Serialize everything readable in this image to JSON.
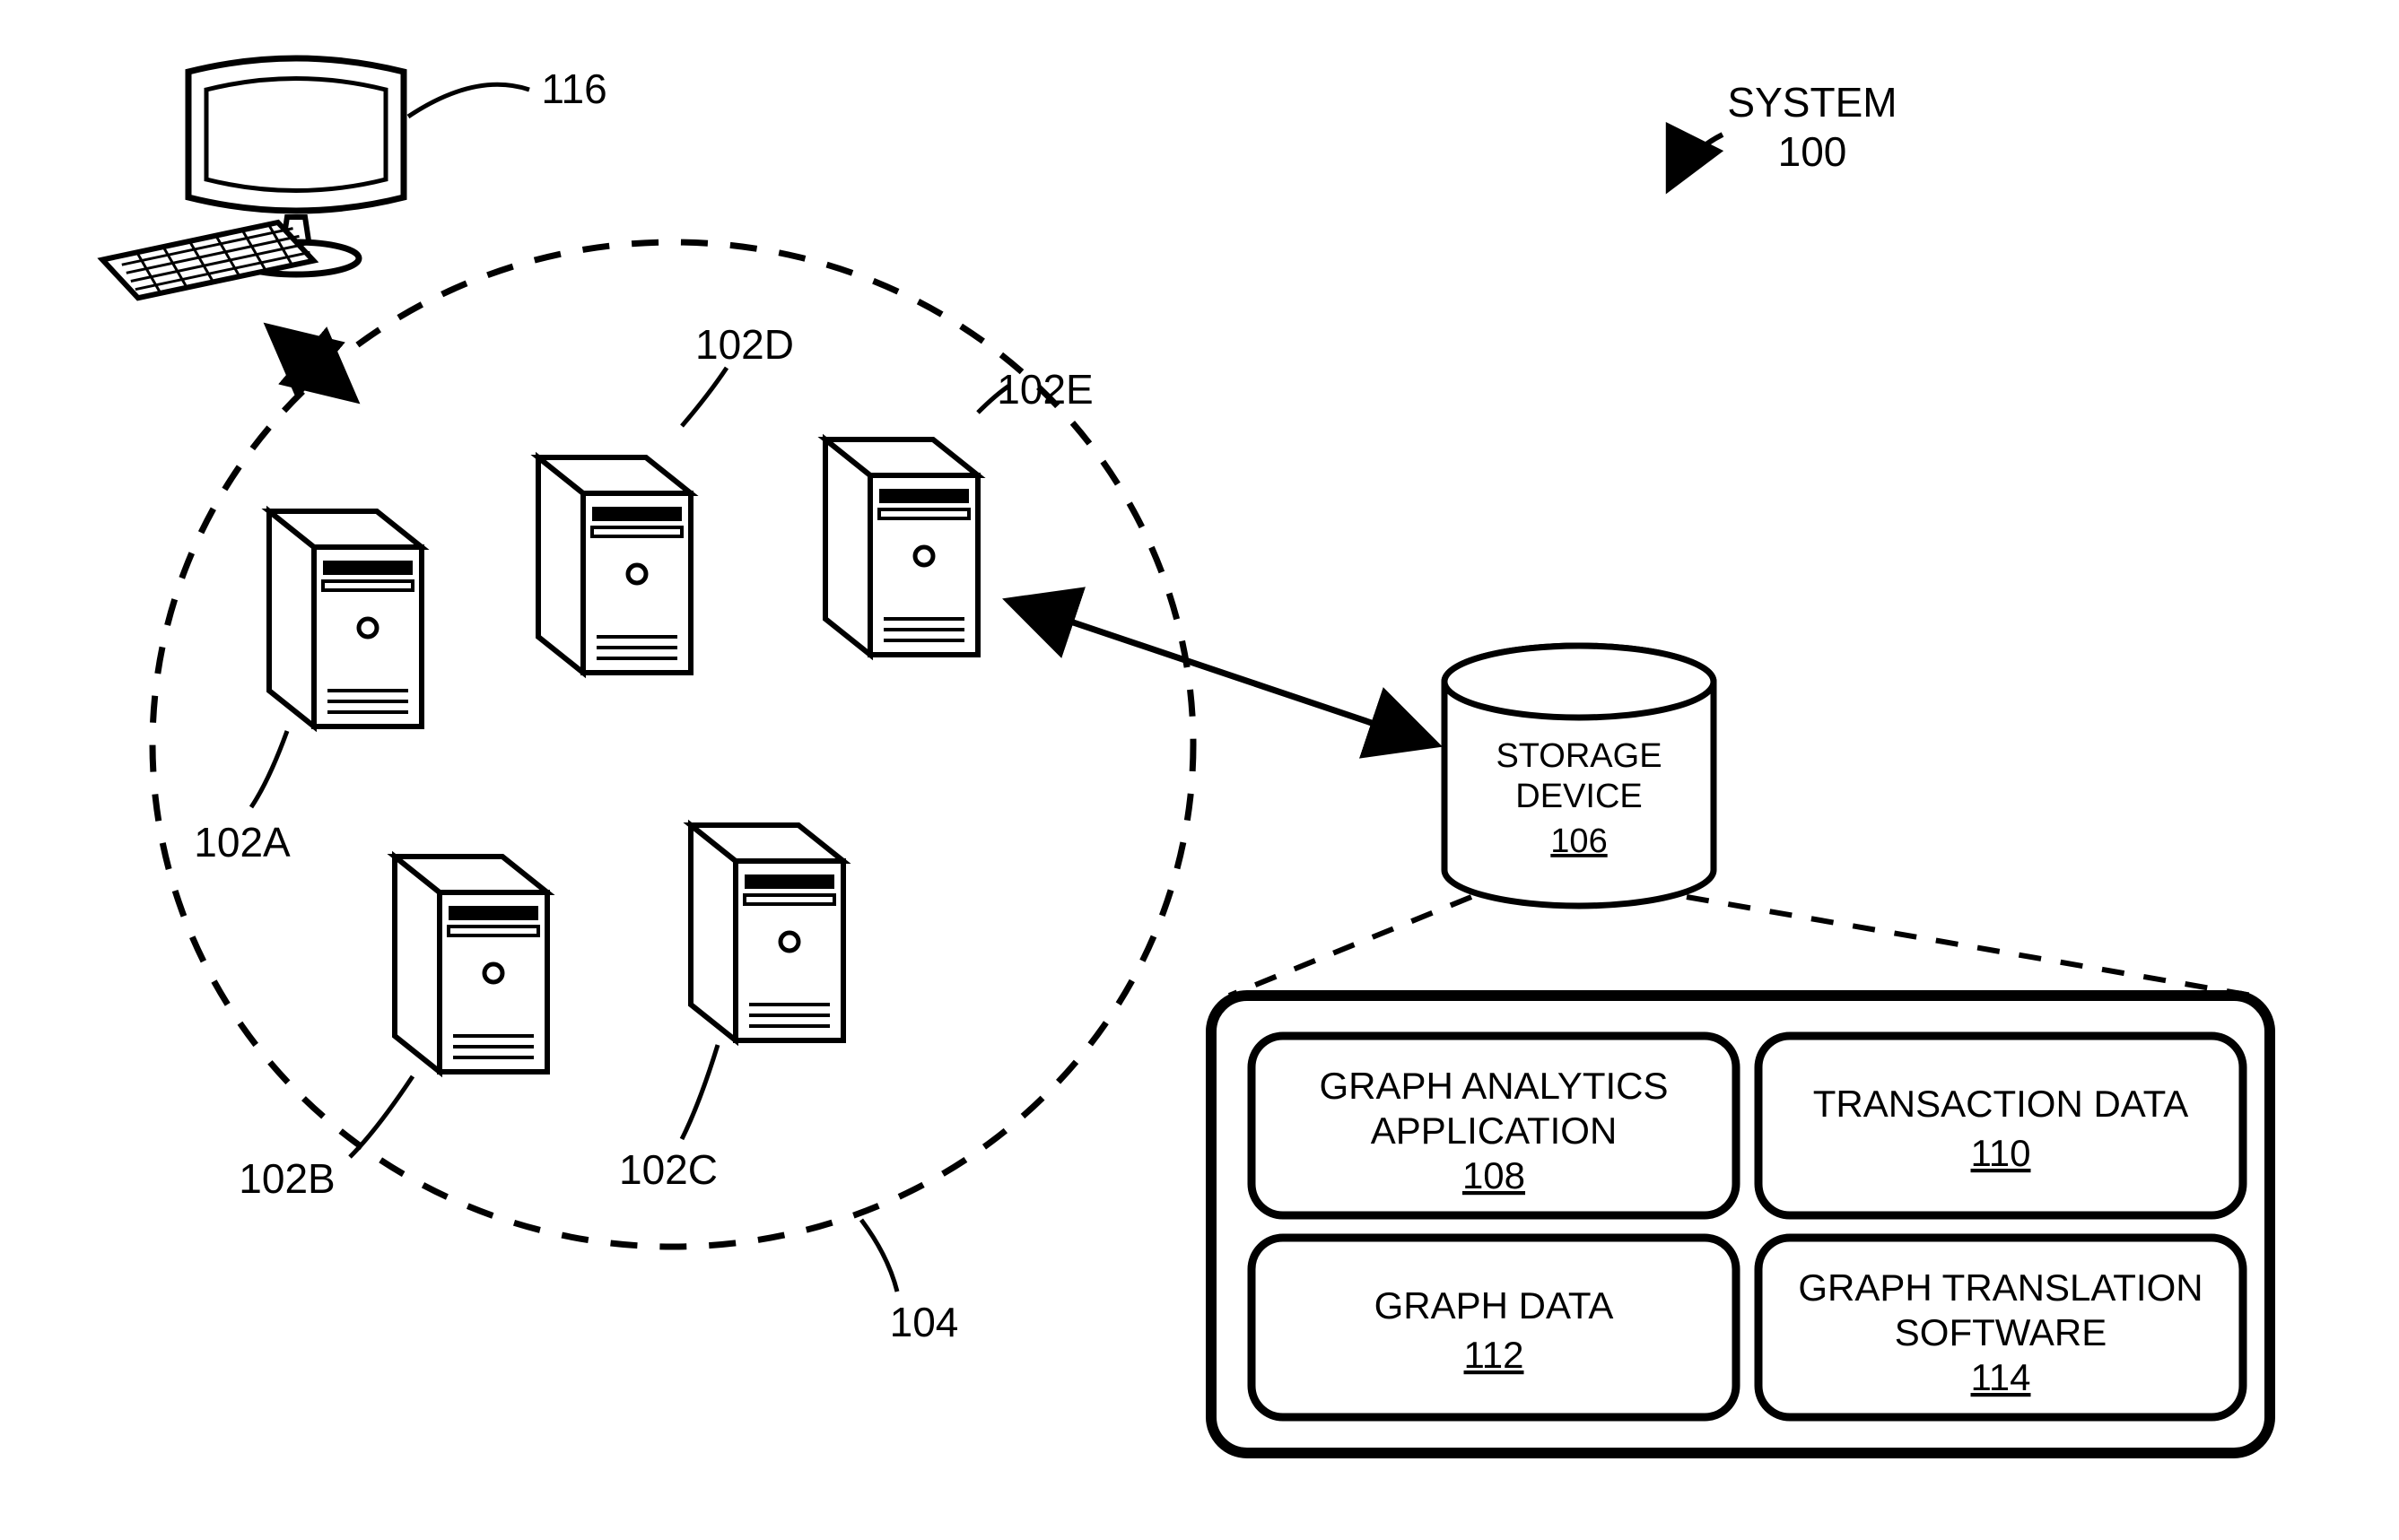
{
  "system": {
    "title": "SYSTEM",
    "ref": "100"
  },
  "client": {
    "ref": "116"
  },
  "cluster": {
    "ref": "104",
    "servers": {
      "a": "102A",
      "b": "102B",
      "c": "102C",
      "d": "102D",
      "e": "102E"
    }
  },
  "storage": {
    "title_line1": "STORAGE",
    "title_line2": "DEVICE",
    "ref": "106",
    "contents": {
      "app": {
        "line1": "GRAPH ANALYTICS",
        "line2": "APPLICATION",
        "ref": "108"
      },
      "txn": {
        "line1": "TRANSACTION DATA",
        "ref": "110"
      },
      "gdata": {
        "line1": "GRAPH DATA",
        "ref": "112"
      },
      "trans": {
        "line1": "GRAPH TRANSLATION",
        "line2": "SOFTWARE",
        "ref": "114"
      }
    }
  }
}
